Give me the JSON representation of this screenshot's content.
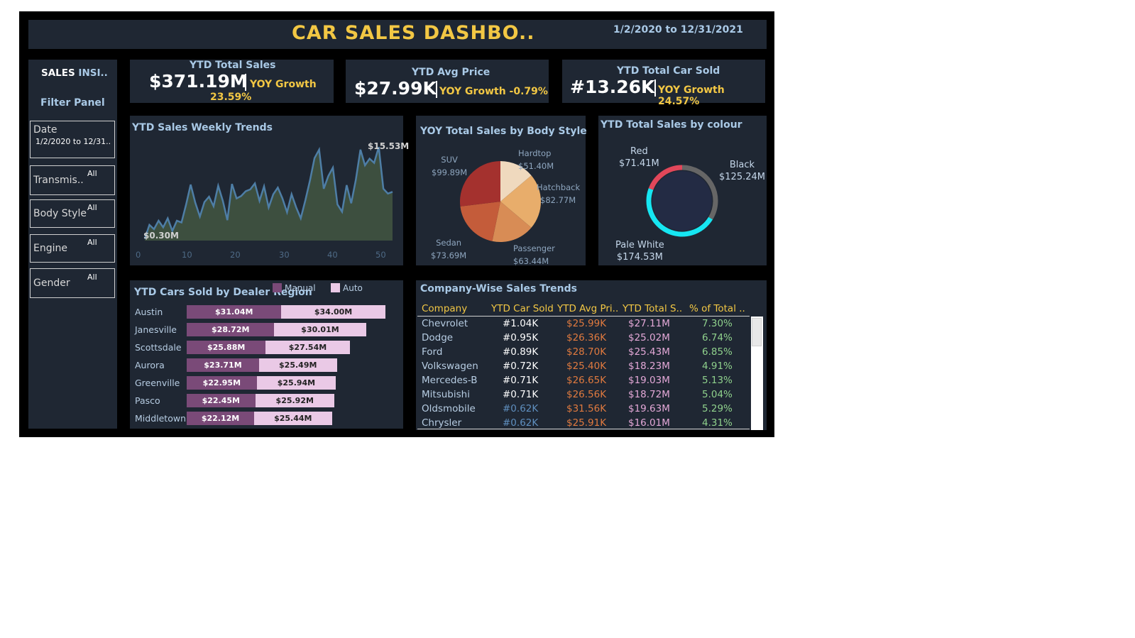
{
  "header": {
    "title": "CAR SALES DASHBO..",
    "date_range": "1/2/2020 to 12/31/2021"
  },
  "sidebar": {
    "title_prefix": "SALES",
    "title_suffix": "INSI..",
    "filter_title": "Filter Panel",
    "filters": [
      {
        "label": "Date",
        "value": "1/2/2020 to 12/31.."
      },
      {
        "label": "Transmis..",
        "value": "All"
      },
      {
        "label": "Body Style",
        "value": "All"
      },
      {
        "label": "Engine",
        "value": "All"
      },
      {
        "label": "Gender",
        "value": "All"
      }
    ]
  },
  "kpis": [
    {
      "title": "YTD Total Sales",
      "value": "$371.19M",
      "growth_label": "YOY Growth",
      "growth_value": "23.59%"
    },
    {
      "title": "YTD Avg Price",
      "value": "$27.99K",
      "growth_label": "YOY Growth -0.79%"
    },
    {
      "title": "YTD Total Car Sold",
      "value": "#13.26K",
      "growth_label": "YOY Growth 24.57%"
    }
  ],
  "weekly_trend": {
    "title": "YTD Sales Weekly Trends",
    "max_label": "$15.53M",
    "min_label": "$0.30M",
    "x_ticks": [
      "0",
      "10",
      "20",
      "30",
      "40",
      "50"
    ]
  },
  "body_style": {
    "title": "YOY Total Sales by Body Style",
    "slices": [
      {
        "name": "Hardtop",
        "value_label": "$51.40M"
      },
      {
        "name": "Hatchback",
        "value_label": "$82.77M"
      },
      {
        "name": "Passenger",
        "value_label": "$63.44M"
      },
      {
        "name": "Sedan",
        "value_label": "$73.69M"
      },
      {
        "name": "SUV",
        "value_label": "$99.89M"
      }
    ]
  },
  "colour": {
    "title": "YTD Total Sales by colour",
    "segments": [
      {
        "name": "Red",
        "value_label": "$71.41M"
      },
      {
        "name": "Black",
        "value_label": "$125.24M"
      },
      {
        "name": "Pale White",
        "value_label": "$174.53M"
      }
    ]
  },
  "dealer_region": {
    "title": "YTD Cars Sold by Dealer Region",
    "legend": [
      "Manual",
      "Auto"
    ],
    "rows": [
      {
        "region": "Austin",
        "manual": "$31.04M",
        "auto": "$34.00M"
      },
      {
        "region": "Janesville",
        "manual": "$28.72M",
        "auto": "$30.01M"
      },
      {
        "region": "Scottsdale",
        "manual": "$25.88M",
        "auto": "$27.54M"
      },
      {
        "region": "Aurora",
        "manual": "$23.71M",
        "auto": "$25.49M"
      },
      {
        "region": "Greenville",
        "manual": "$22.95M",
        "auto": "$25.94M"
      },
      {
        "region": "Pasco",
        "manual": "$22.45M",
        "auto": "$25.92M"
      },
      {
        "region": "Middletown",
        "manual": "$22.12M",
        "auto": "$25.44M"
      }
    ]
  },
  "company_table": {
    "title": "Company-Wise Sales Trends",
    "columns": [
      "Company",
      "YTD Car Sold",
      "YTD Avg Pri..",
      "YTD Total S..",
      "% of Total .."
    ],
    "rows": [
      [
        "Chevrolet",
        "#1.04K",
        "$25.99K",
        "$27.11M",
        "7.30%"
      ],
      [
        "Dodge",
        "#0.95K",
        "$26.36K",
        "$25.02M",
        "6.74%"
      ],
      [
        "Ford",
        "#0.89K",
        "$28.70K",
        "$25.43M",
        "6.85%"
      ],
      [
        "Volkswagen",
        "#0.72K",
        "$25.40K",
        "$18.23M",
        "4.91%"
      ],
      [
        "Mercedes-B",
        "#0.71K",
        "$26.65K",
        "$19.03M",
        "5.13%"
      ],
      [
        "Mitsubishi",
        "#0.71K",
        "$26.56K",
        "$18.72M",
        "5.04%"
      ],
      [
        "Oldsmobile",
        "#0.62K",
        "$31.56K",
        "$19.63M",
        "5.29%"
      ],
      [
        "Chrysler",
        "#0.62K",
        "$25.91K",
        "$16.01M",
        "4.31%"
      ]
    ]
  },
  "chart_data": [
    {
      "type": "area",
      "title": "YTD Sales Weekly Trends",
      "x": [
        1,
        2,
        3,
        4,
        5,
        6,
        7,
        8,
        9,
        10,
        11,
        12,
        13,
        14,
        15,
        16,
        17,
        18,
        19,
        20,
        21,
        22,
        23,
        24,
        25,
        26,
        27,
        28,
        29,
        30,
        31,
        32,
        33,
        34,
        35,
        36,
        37,
        38,
        39,
        40,
        41,
        42,
        43,
        44,
        45,
        46,
        47,
        48,
        49,
        50,
        51,
        52,
        53
      ],
      "y": [
        0.3,
        2.6,
        1.9,
        3.3,
        2.2,
        3.7,
        1.6,
        3.3,
        3.0,
        6.0,
        9.3,
        6.3,
        4.0,
        6.4,
        7.3,
        5.7,
        9.1,
        6.6,
        3.4,
        9.4,
        7.0,
        7.4,
        8.2,
        8.5,
        9.5,
        6.6,
        9.0,
        5.5,
        7.7,
        8.8,
        7.0,
        4.7,
        7.7,
        5.5,
        3.7,
        6.7,
        10.0,
        13.7,
        15.1,
        8.6,
        10.7,
        12.1,
        6.0,
        4.8,
        9.2,
        6.2,
        10.1,
        15.1,
        12.5,
        13.6,
        12.9,
        15.53,
        8.6,
        7.8,
        8.1
      ],
      "xlim": [
        0,
        53
      ],
      "ylim": [
        0,
        16.5
      ],
      "xticks": [
        0,
        10,
        20,
        30,
        40,
        50
      ],
      "color": "#4e7ea6",
      "fill": "#3d4f3f"
    },
    {
      "type": "pie",
      "title": "YOY Total Sales by Body Style",
      "labels": [
        "Hardtop",
        "Hatchback",
        "Passenger",
        "Sedan",
        "SUV"
      ],
      "values": [
        51.4,
        82.77,
        63.44,
        73.69,
        99.89
      ],
      "colors": [
        "#efd9be",
        "#e8ad6b",
        "#d88c55",
        "#c45c3a",
        "#a4312e"
      ]
    },
    {
      "type": "pie",
      "title": "YTD Total Sales by colour",
      "donut": true,
      "labels": [
        "Black",
        "Pale White",
        "Red"
      ],
      "values": [
        125.24,
        174.53,
        71.41
      ],
      "colors": [
        "#666666",
        "#16e6f2",
        "#e2475a"
      ]
    },
    {
      "type": "bar",
      "title": "YTD Cars Sold by Dealer Region",
      "orientation": "horizontal",
      "stacked": true,
      "categories": [
        "Austin",
        "Janesville",
        "Scottsdale",
        "Aurora",
        "Greenville",
        "Pasco",
        "Middletown"
      ],
      "series": [
        {
          "name": "Manual",
          "values": [
            31.04,
            28.72,
            25.88,
            23.71,
            22.95,
            22.45,
            22.12
          ],
          "color": "#7a4a78"
        },
        {
          "name": "Auto",
          "values": [
            34.0,
            30.01,
            27.54,
            25.49,
            25.94,
            25.92,
            25.44
          ],
          "color": "#eac9e6"
        }
      ],
      "legend": "top"
    }
  ]
}
